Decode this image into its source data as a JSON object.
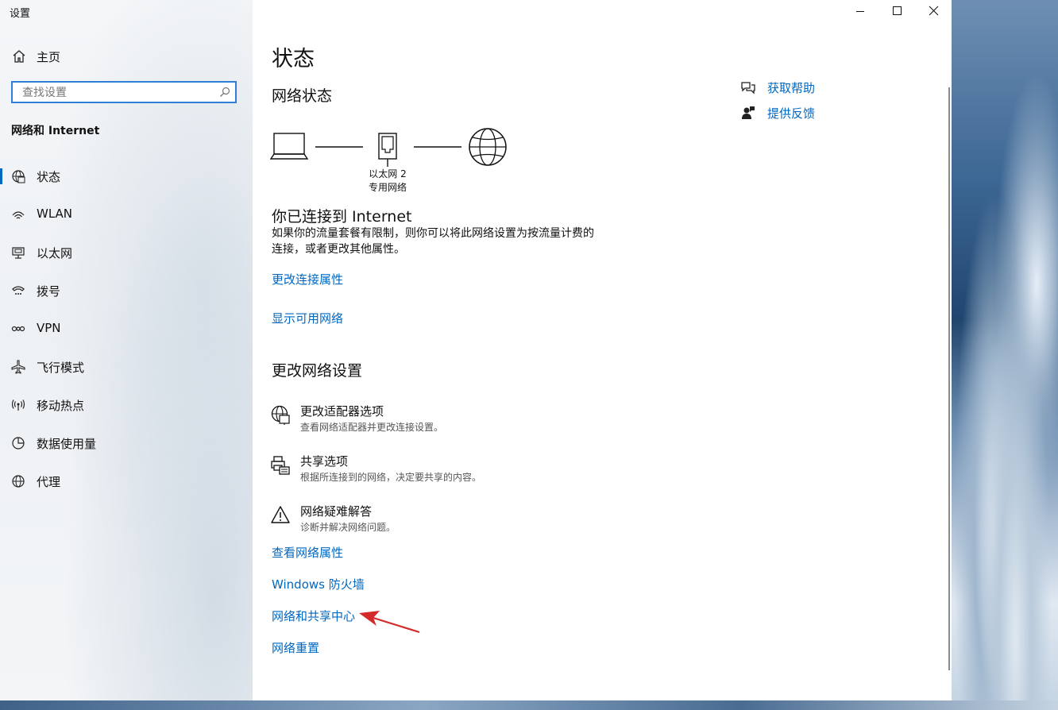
{
  "window": {
    "title": "设置"
  },
  "sidebar": {
    "home_label": "主页",
    "search_placeholder": "查找设置",
    "section_title": "网络和 Internet",
    "items": [
      {
        "label": "状态",
        "icon": "status-globe-icon",
        "selected": true
      },
      {
        "label": "WLAN",
        "icon": "wifi-icon",
        "selected": false
      },
      {
        "label": "以太网",
        "icon": "ethernet-icon",
        "selected": false
      },
      {
        "label": "拨号",
        "icon": "dialup-icon",
        "selected": false
      },
      {
        "label": "VPN",
        "icon": "vpn-icon",
        "selected": false
      },
      {
        "label": "飞行模式",
        "icon": "airplane-icon",
        "selected": false
      },
      {
        "label": "移动热点",
        "icon": "hotspot-icon",
        "selected": false
      },
      {
        "label": "数据使用量",
        "icon": "data-usage-icon",
        "selected": false
      },
      {
        "label": "代理",
        "icon": "proxy-globe-icon",
        "selected": false
      }
    ]
  },
  "main": {
    "title": "状态",
    "network_status_title": "网络状态",
    "adapter_name": "以太网 2",
    "network_profile": "专用网络",
    "connected_title": "你已连接到 Internet",
    "connected_desc": "如果你的流量套餐有限制，则你可以将此网络设置为按流量计费的连接，或者更改其他属性。",
    "links_top": {
      "change_props": "更改连接属性",
      "show_networks": "显示可用网络"
    },
    "change_settings_title": "更改网络设置",
    "settings": [
      {
        "title": "更改适配器选项",
        "desc": "查看网络适配器并更改连接设置。",
        "icon": "adapter-globe-icon"
      },
      {
        "title": "共享选项",
        "desc": "根据所连接到的网络，决定要共享的内容。",
        "icon": "sharing-printer-icon"
      },
      {
        "title": "网络疑难解答",
        "desc": "诊断并解决网络问题。",
        "icon": "warning-icon"
      }
    ],
    "links_bottom": {
      "view_props": "查看网络属性",
      "firewall": "Windows 防火墙",
      "sharing_center": "网络和共享中心",
      "reset": "网络重置"
    }
  },
  "help": {
    "get_help": "获取帮助",
    "feedback": "提供反馈"
  },
  "colors": {
    "accent": "#0067c0",
    "annotation_arrow": "#d42a2a",
    "search_border": "#2f7fd6"
  }
}
